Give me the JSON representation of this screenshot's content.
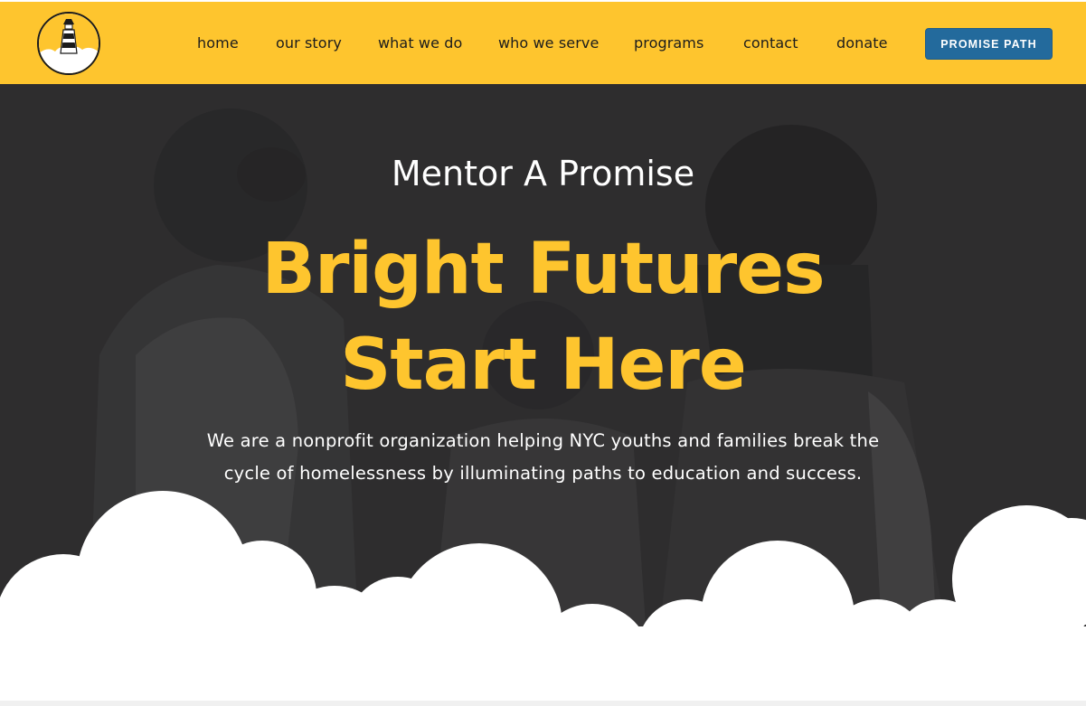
{
  "header": {
    "logo_icon": "lighthouse-icon",
    "nav": [
      {
        "label": "home"
      },
      {
        "label": "our story"
      },
      {
        "label": "what we do"
      },
      {
        "label": "who we serve"
      },
      {
        "label": "programs"
      },
      {
        "label": "contact"
      },
      {
        "label": "donate"
      }
    ],
    "cta_label": "PROMISE PATH"
  },
  "hero": {
    "eyebrow": "Mentor A Promise",
    "headline_line1": "Bright Futures",
    "headline_line2": "Start Here",
    "description": "We are a nonprofit organization helping NYC youths and families break the cycle of homelessness by illuminating paths to education and success."
  },
  "colors": {
    "brand_yellow": "#fec52e",
    "cta_blue": "#236a9c",
    "hero_dark": "#2e2d2f",
    "text_dark": "#1c1c1c"
  }
}
